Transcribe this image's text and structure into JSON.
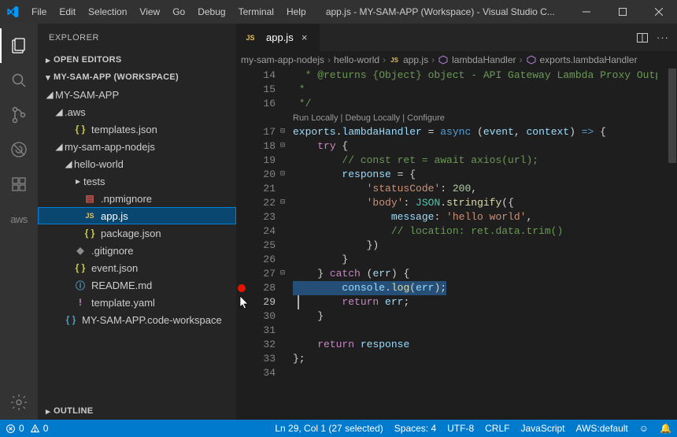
{
  "title": "app.js - MY-SAM-APP (Workspace) - Visual Studio C...",
  "menu": [
    "File",
    "Edit",
    "Selection",
    "View",
    "Go",
    "Debug",
    "Terminal",
    "Help"
  ],
  "activitybar": {
    "items": [
      {
        "name": "explorer-icon",
        "active": true
      },
      {
        "name": "search-icon",
        "active": false
      },
      {
        "name": "scm-icon",
        "active": false
      },
      {
        "name": "debug-icon",
        "active": false
      },
      {
        "name": "extensions-icon",
        "active": false
      },
      {
        "name": "aws-icon",
        "active": false
      }
    ],
    "bottom": {
      "name": "settings-gear-icon"
    }
  },
  "sidebar": {
    "title": "EXPLORER",
    "open_editors": "OPEN EDITORS",
    "workspace_section": "MY-SAM-APP (WORKSPACE)",
    "tree": [
      {
        "depth": 0,
        "type": "folder-open",
        "label": "MY-SAM-APP"
      },
      {
        "depth": 1,
        "type": "folder-open",
        "label": ".aws"
      },
      {
        "depth": 2,
        "type": "json",
        "label": "templates.json"
      },
      {
        "depth": 1,
        "type": "folder-open",
        "label": "my-sam-app-nodejs"
      },
      {
        "depth": 2,
        "type": "folder-open",
        "label": "hello-world"
      },
      {
        "depth": 3,
        "type": "folder-closed",
        "label": "tests"
      },
      {
        "depth": 3,
        "type": "npm",
        "label": ".npmignore"
      },
      {
        "depth": 3,
        "type": "js",
        "label": "app.js",
        "focused": true
      },
      {
        "depth": 3,
        "type": "json",
        "label": "package.json"
      },
      {
        "depth": 2,
        "type": "git",
        "label": ".gitignore"
      },
      {
        "depth": 2,
        "type": "json",
        "label": "event.json"
      },
      {
        "depth": 2,
        "type": "info",
        "label": "README.md"
      },
      {
        "depth": 2,
        "type": "yaml",
        "label": "template.yaml"
      },
      {
        "depth": 1,
        "type": "workspace",
        "label": "MY-SAM-APP.code-workspace"
      }
    ],
    "outline": "OUTLINE"
  },
  "tabs": {
    "active": {
      "icon": "js",
      "label": "app.js"
    }
  },
  "breadcrumb": [
    {
      "label": "my-sam-app-nodejs",
      "icon": ""
    },
    {
      "label": "hello-world",
      "icon": ""
    },
    {
      "label": "app.js",
      "icon": "js"
    },
    {
      "label": "lambdaHandler",
      "icon": "method"
    },
    {
      "label": "exports.lambdaHandler",
      "icon": "method"
    }
  ],
  "codelens": [
    "Run Locally",
    "Debug Locally",
    "Configure"
  ],
  "editor": {
    "first_line_number": 14,
    "lines": [
      {
        "n": 14,
        "fold": "",
        "html": "<span class='c-comment'>  * @returns {Object} object - API Gateway Lambda Proxy Output F</span>"
      },
      {
        "n": 15,
        "fold": "",
        "html": "<span class='c-comment'> *</span>"
      },
      {
        "n": 16,
        "fold": "",
        "html": "<span class='c-comment'> */</span>"
      },
      {
        "n": 0,
        "codelens": true
      },
      {
        "n": 17,
        "fold": "⊟",
        "html": "<span class='c-var'>exports</span>.<span class='c-var'>lambdaHandler</span> = <span class='c-keyword'>async</span> (<span class='c-var'>event</span>, <span class='c-var'>context</span>) <span class='c-keyword'>=&gt;</span> {"
      },
      {
        "n": 18,
        "fold": "⊟",
        "html": "    <span class='c-keyword2'>try</span> {"
      },
      {
        "n": 19,
        "fold": "",
        "html": "        <span class='c-comment'>// const ret = await axios(url);</span>"
      },
      {
        "n": 20,
        "fold": "⊟",
        "html": "        <span class='c-var'>response</span> = {"
      },
      {
        "n": 21,
        "fold": "",
        "html": "            <span class='c-str'>'statusCode'</span>: <span class='c-num'>200</span>,"
      },
      {
        "n": 22,
        "fold": "⊟",
        "html": "            <span class='c-str'>'body'</span>: <span class='c-type'>JSON</span>.<span class='c-fn'>stringify</span>({"
      },
      {
        "n": 23,
        "fold": "",
        "html": "                <span class='c-var'>message</span>: <span class='c-str'>'hello world'</span>,"
      },
      {
        "n": 24,
        "fold": "",
        "html": "                <span class='c-comment'>// location: ret.data.trim()</span>"
      },
      {
        "n": 25,
        "fold": "",
        "html": "            })"
      },
      {
        "n": 26,
        "fold": "",
        "html": "        }"
      },
      {
        "n": 27,
        "fold": "⊟",
        "html": "    } <span class='c-keyword2'>catch</span> (<span class='c-var'>err</span>) {"
      },
      {
        "n": 28,
        "fold": "",
        "bp": true,
        "sel": true,
        "html": "        <span class='c-var'>console</span>.<span class='c-fn'>log</span>(<span class='c-var'>err</span>);"
      },
      {
        "n": 29,
        "fold": "",
        "cursorline": true,
        "html": "        <span class='c-keyword2'>return</span> <span class='c-var'>err</span>;"
      },
      {
        "n": 30,
        "fold": "",
        "html": "    }"
      },
      {
        "n": 31,
        "fold": "",
        "html": ""
      },
      {
        "n": 32,
        "fold": "",
        "html": "    <span class='c-keyword2'>return</span> <span class='c-var'>response</span>"
      },
      {
        "n": 33,
        "fold": "",
        "html": "};"
      },
      {
        "n": 34,
        "fold": "",
        "html": ""
      }
    ]
  },
  "status": {
    "errors": "0",
    "warnings": "0",
    "position": "Ln 29, Col 1 (27 selected)",
    "spaces": "Spaces: 4",
    "encoding": "UTF-8",
    "eol": "CRLF",
    "language": "JavaScript",
    "aws": "AWS:default",
    "feedback_icon": "☺",
    "bell_icon": "🔔"
  }
}
